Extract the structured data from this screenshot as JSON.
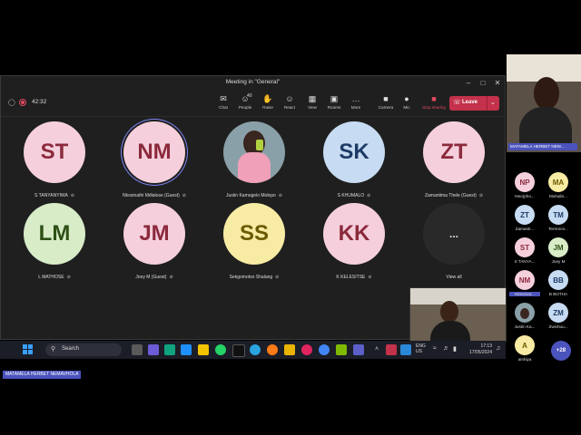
{
  "window": {
    "title": "Meeting in \"General\""
  },
  "meeting": {
    "timer": "42:32"
  },
  "toolbar": {
    "buttons": [
      {
        "label": "Chat",
        "icon": "chat-icon"
      },
      {
        "label": "People",
        "icon": "people-icon",
        "count": "40"
      },
      {
        "label": "Raise",
        "icon": "raise-hand-icon"
      },
      {
        "label": "React",
        "icon": "react-icon"
      },
      {
        "label": "View",
        "icon": "view-icon"
      },
      {
        "label": "Rooms",
        "icon": "rooms-icon"
      },
      {
        "label": "More",
        "icon": "more-icon"
      },
      {
        "label": "Camera",
        "icon": "camera-icon"
      },
      {
        "label": "Mic",
        "icon": "mic-icon"
      },
      {
        "label": "Stop sharing",
        "icon": "stop-share-icon"
      }
    ],
    "leave_label": "Leave"
  },
  "tiles": [
    {
      "initials": "ST",
      "name": "S TANYANYIWA",
      "bg": "#f5d0dc",
      "fg": "#8b2a3c"
    },
    {
      "initials": "NM",
      "name": "Nkosinathi Mdlalose (Guest)",
      "bg": "#f5d0dc",
      "fg": "#8b2a3c",
      "speaking": true
    },
    {
      "initials": "",
      "name": "Justin Kamogelo Molepo",
      "photo": true
    },
    {
      "initials": "SK",
      "name": "S KHUMALO",
      "bg": "#c7dcf2",
      "fg": "#1e3a66"
    },
    {
      "initials": "ZT",
      "name": "Zamantima Thele (Guest)",
      "bg": "#f5d0dc",
      "fg": "#8b2a3c"
    },
    {
      "initials": "LM",
      "name": "L MATHOSE",
      "bg": "#d8ecc8",
      "fg": "#2e5016"
    },
    {
      "initials": "JM",
      "name": "Joey M (Guest)",
      "bg": "#f5d0dc",
      "fg": "#8b2a3c"
    },
    {
      "initials": "SS",
      "name": "Sekgomotso Shalang",
      "bg": "#f8eba4",
      "fg": "#6b5a00"
    },
    {
      "initials": "KK",
      "name": "K KELESITSE",
      "bg": "#f5d0dc",
      "fg": "#8b2a3c"
    },
    {
      "initials": "...",
      "name": "View all",
      "overflow": true
    }
  ],
  "self_view": {
    "name": "MATAMELA HERBET NEM..."
  },
  "panel_participants": [
    {
      "initials": "NP",
      "name": "Neo(pho...",
      "bg": "#f5d0dc",
      "fg": "#8b2a3c"
    },
    {
      "initials": "MA",
      "name": "Muhalin...",
      "bg": "#f8eba4",
      "fg": "#6b5a00"
    },
    {
      "initials": "ZT",
      "name": "Zamanti...",
      "bg": "#c7dcf2",
      "fg": "#1e3a66"
    },
    {
      "initials": "TM",
      "name": "Terrence...",
      "bg": "#c7dcf2",
      "fg": "#1e3a66"
    },
    {
      "initials": "ST",
      "name": "S TANYA...",
      "bg": "#f5d0dc",
      "fg": "#8b2a3c"
    },
    {
      "initials": "JM",
      "name": "Joey M",
      "bg": "#d8ecc8",
      "fg": "#2e5016"
    },
    {
      "initials": "NM",
      "name": "Nkosinat...",
      "bg": "#f5d0dc",
      "fg": "#8b2a3c",
      "highlight": true
    },
    {
      "initials": "BB",
      "name": "B BOTHA",
      "bg": "#c7dcf2",
      "fg": "#1e3a66"
    },
    {
      "initials": "",
      "name": "Justin Ka...",
      "photo": true
    },
    {
      "initials": "ZM",
      "name": "Zwivhuu...",
      "bg": "#c7dcf2",
      "fg": "#1e3a66"
    },
    {
      "initials": "A",
      "name": "amhiya",
      "bg": "#f8eba4",
      "fg": "#6b5a00"
    }
  ],
  "panel_more": "+28",
  "taskbar": {
    "search_placeholder": "Search",
    "lang": "ENG",
    "region": "US",
    "time": "17:13",
    "date": "17/05/2024"
  },
  "sharing_label": "MATAMELA HERBET NEMAVHOLA"
}
